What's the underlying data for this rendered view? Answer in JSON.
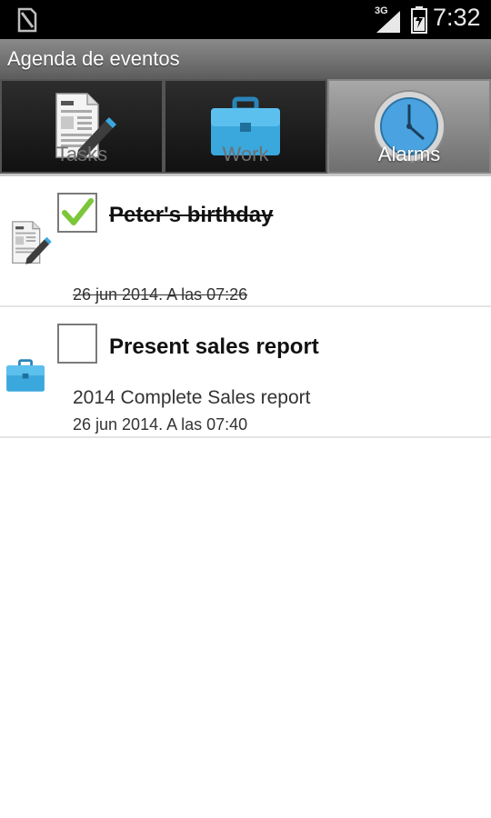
{
  "status_bar": {
    "network": "3G",
    "time": "7:32",
    "icons": [
      "sd-card-icon",
      "signal-icon",
      "battery-icon"
    ]
  },
  "app": {
    "title": "Agenda de eventos"
  },
  "tabs": [
    {
      "label": "Tasks",
      "icon": "document-pen-icon",
      "selected": false
    },
    {
      "label": "Work",
      "icon": "briefcase-icon",
      "selected": false
    },
    {
      "label": "Alarms",
      "icon": "clock-icon",
      "selected": true
    }
  ],
  "events": [
    {
      "icon": "document-pen-icon",
      "checked": true,
      "title": "Peter's birthday",
      "description": "",
      "date": "26 jun 2014.  A las 07:26"
    },
    {
      "icon": "briefcase-icon",
      "checked": false,
      "title": "Present sales report",
      "description": "2014 Complete Sales report",
      "date": "26 jun 2014.  A las 07:40"
    }
  ],
  "colors": {
    "checkmark": "#7cc63a",
    "briefcase": "#3aa7dd",
    "clock": "#4aa3e0"
  }
}
